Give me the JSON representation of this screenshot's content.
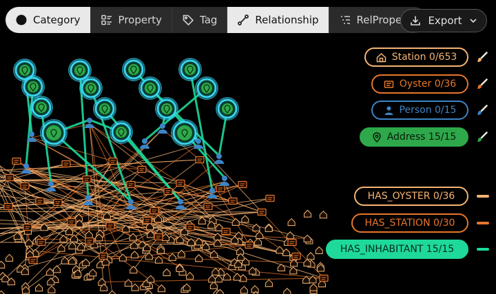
{
  "toolbar": {
    "tabs": [
      {
        "label": "Category",
        "icon": "filled-circle-icon"
      },
      {
        "label": "Property",
        "icon": "property-list-icon"
      },
      {
        "label": "Tag",
        "icon": "tag-icon"
      },
      {
        "label": "Relationship",
        "icon": "relationship-edge-icon"
      },
      {
        "label": "RelProperty",
        "icon": "rel-property-list-icon"
      }
    ],
    "active_tabs": [
      "Category",
      "Relationship"
    ],
    "export_label": "Export"
  },
  "legend": {
    "categories": [
      {
        "label": "Station 0/653",
        "color": "#f5b474",
        "fill": "transparent",
        "icon": "station-house-icon",
        "text_color": "#f5b474"
      },
      {
        "label": "Oyster 0/36",
        "color": "#e8762b",
        "fill": "transparent",
        "icon": "oyster-card-icon",
        "text_color": "#e8762b"
      },
      {
        "label": "Person 0/15",
        "color": "#3d84c6",
        "fill": "transparent",
        "icon": "person-icon",
        "text_color": "#3d84c6"
      },
      {
        "label": "Address 15/15",
        "color": "#2ea84a",
        "fill": "#2ea84a",
        "icon": "location-pin-icon",
        "text_color": "#0b1a0b"
      }
    ],
    "relationships": [
      {
        "label": "HAS_OYSTER 0/36",
        "color": "#f5b474",
        "fill": "transparent",
        "text_color": "#f5b474"
      },
      {
        "label": "HAS_STATION 0/30",
        "color": "#e8762b",
        "fill": "transparent",
        "text_color": "#e8762b"
      },
      {
        "label": "HAS_INHABITANT 15/15",
        "color": "#1ed99a",
        "fill": "#1ed99a",
        "text_color": "#062a1d"
      }
    ]
  },
  "colors": {
    "station": "#f5b474",
    "oyster": "#e8762b",
    "person": "#3d84c6",
    "address": "#2ea84a",
    "address_glow": "#39d4f0",
    "inhabitant_edge": "#1ed99a"
  }
}
